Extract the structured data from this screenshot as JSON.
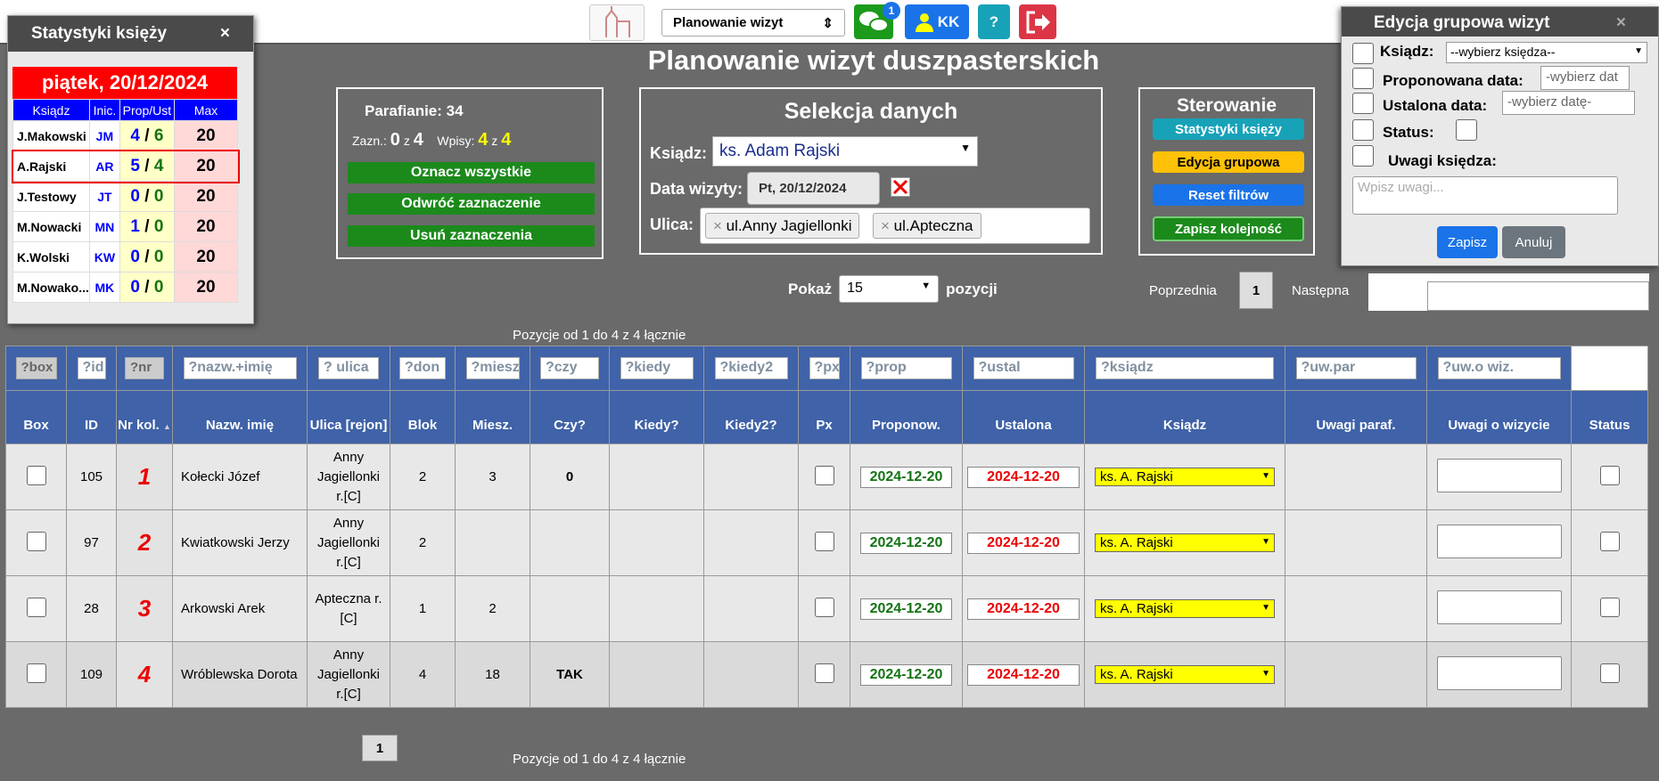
{
  "toolbar": {
    "mode": "Planowanie wizyt",
    "messages_badge": "1",
    "user": "KK",
    "help": "?"
  },
  "title": "Planowanie wizyt duszpasterskich",
  "stats_panel": {
    "title": "Statystyki księży",
    "date": "piątek, 20/12/2024",
    "headers": [
      "Ksiądz",
      "Inic.",
      "Prop/Ust",
      "Max"
    ],
    "rows": [
      {
        "name": "J.Makowski",
        "inic": "JM",
        "prop": "4",
        "ust": "6",
        "max": "20"
      },
      {
        "name": "A.Rajski",
        "inic": "AR",
        "prop": "5",
        "ust": "4",
        "max": "20"
      },
      {
        "name": "J.Testowy",
        "inic": "JT",
        "prop": "0",
        "ust": "0",
        "max": "20"
      },
      {
        "name": "M.Nowacki",
        "inic": "MN",
        "prop": "1",
        "ust": "0",
        "max": "20"
      },
      {
        "name": "K.Wolski",
        "inic": "KW",
        "prop": "0",
        "ust": "0",
        "max": "20"
      },
      {
        "name": "M.Nowako...",
        "inic": "MK",
        "prop": "0",
        "ust": "0",
        "max": "20"
      }
    ]
  },
  "parishioners": {
    "title": "Parafianie: 34",
    "zazn_label": "Zazn.:",
    "zazn_val": "0",
    "z": "z",
    "zazn_tot": "4",
    "wpisy_label": "Wpisy:",
    "wpisy_val": "4",
    "wpisy_tot": "4",
    "btn_mark_all": "Oznacz wszystkie",
    "btn_invert": "Odwróć zaznaczenie",
    "btn_clear": "Usuń zaznaczenia"
  },
  "selection": {
    "title": "Selekcja danych",
    "priest_label": "Ksiądz:",
    "priest_value": "ks. Adam Rajski",
    "date_label": "Data wizyty:",
    "date_value": "Pt, 20/12/2024",
    "street_label": "Ulica:",
    "streets": [
      "ul.Anny Jagiellonki",
      "ul.Apteczna"
    ]
  },
  "control": {
    "title": "Sterowanie",
    "btn_stats": "Statystyki księży",
    "btn_group": "Edycja grupowa",
    "btn_reset": "Reset filtrów",
    "btn_save": "Zapisz kolejność"
  },
  "group_edit": {
    "title": "Edycja grupowa wizyt",
    "priest_label": "Ksiądz:",
    "priest_value": "--wybierz księdza--",
    "prop_label": "Proponowana data:",
    "prop_ph": "-wybierz dat",
    "ust_label": "Ustalona data:",
    "ust_ph": "-wybierz datę-",
    "status_label": "Status:",
    "notes_label": "Uwagi księdza:",
    "notes_ph": "Wpisz uwagi...",
    "save": "Zapisz",
    "cancel": "Anuluj"
  },
  "show": {
    "label": "Pokaż",
    "value": "15",
    "suffix": "pozycji"
  },
  "pagination": {
    "prev": "Poprzednia",
    "page": "1",
    "next": "Następna"
  },
  "info": "Pozycje od 1 do 4 z 4 łącznie",
  "filters": [
    "?box",
    "?id",
    "?nr",
    "?nazw.+imię",
    "? ulica",
    "?don",
    "?miesz",
    "?czy",
    "?kiedy",
    "?kiedy2",
    "?px",
    "?prop",
    "?ustal",
    "?ksiądz",
    "?uw.par",
    "?uw.o wiz."
  ],
  "columns": [
    "Box",
    "ID",
    "Nr kol.",
    "Nazw. imię",
    "Ulica [rejon]",
    "Blok",
    "Miesz.",
    "Czy?",
    "Kiedy?",
    "Kiedy2?",
    "Px",
    "Proponow.",
    "Ustalona",
    "Ksiądz",
    "Uwagi paraf.",
    "Uwagi o wizycie",
    "Status"
  ],
  "rows": [
    {
      "id": "105",
      "nr": "1",
      "name": "Kołecki Józef",
      "street": "Anny Jagiellonki r.[C]",
      "blok": "2",
      "miesz": "3",
      "czy": "0",
      "prop": "2024-12-20",
      "ust": "2024-12-20",
      "ksiadz": "ks. A. Rajski"
    },
    {
      "id": "97",
      "nr": "2",
      "name": "Kwiatkowski Jerzy",
      "street": "Anny Jagiellonki r.[C]",
      "blok": "2",
      "miesz": "",
      "czy": "",
      "prop": "2024-12-20",
      "ust": "2024-12-20",
      "ksiadz": "ks. A. Rajski"
    },
    {
      "id": "28",
      "nr": "3",
      "name": "Arkowski Arek",
      "street": "Apteczna r.[C]",
      "blok": "1",
      "miesz": "2",
      "czy": "",
      "prop": "2024-12-20",
      "ust": "2024-12-20",
      "ksiadz": "ks. A. Rajski"
    },
    {
      "id": "109",
      "nr": "4",
      "name": "Wróblewska Dorota",
      "street": "Anny Jagiellonki r.[C]",
      "blok": "4",
      "miesz": "18",
      "czy": "TAK",
      "prop": "2024-12-20",
      "ust": "2024-12-20",
      "ksiadz": "ks. A. Rajski"
    }
  ],
  "bottom_page": "1",
  "colors": {
    "green": "#1b8a1b",
    "blue_header": "#3f62a8",
    "red": "#ff0000"
  }
}
